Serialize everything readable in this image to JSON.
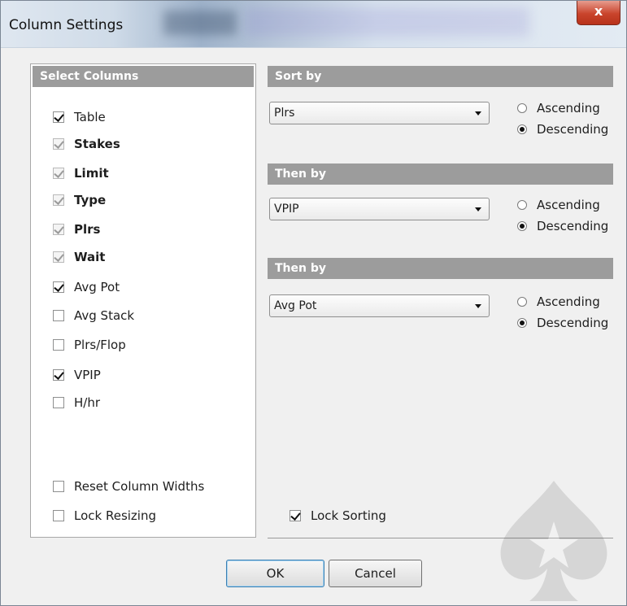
{
  "window": {
    "title": "Column Settings",
    "close_glyph": "x"
  },
  "select_columns": {
    "header": "Select Columns",
    "items": [
      {
        "label": "Table",
        "checked": true,
        "disabled": false,
        "bold": false
      },
      {
        "label": "Stakes",
        "checked": true,
        "disabled": true,
        "bold": true
      },
      {
        "label": "Limit",
        "checked": true,
        "disabled": true,
        "bold": true
      },
      {
        "label": "Type",
        "checked": true,
        "disabled": true,
        "bold": true
      },
      {
        "label": "Plrs",
        "checked": true,
        "disabled": true,
        "bold": true
      },
      {
        "label": "Wait",
        "checked": true,
        "disabled": true,
        "bold": true
      },
      {
        "label": "Avg Pot",
        "checked": true,
        "disabled": false,
        "bold": false
      },
      {
        "label": "Avg Stack",
        "checked": false,
        "disabled": false,
        "bold": false
      },
      {
        "label": "Plrs/Flop",
        "checked": false,
        "disabled": false,
        "bold": false
      },
      {
        "label": "VPIP",
        "checked": true,
        "disabled": false,
        "bold": false
      },
      {
        "label": "H/hr",
        "checked": false,
        "disabled": false,
        "bold": false
      }
    ],
    "reset_widths": {
      "label": "Reset Column Widths",
      "checked": false
    },
    "lock_resizing": {
      "label": "Lock Resizing",
      "checked": false
    }
  },
  "sort": {
    "groups": [
      {
        "header": "Sort by",
        "selected": "Plrs",
        "ascending": "Ascending",
        "descending": "Descending",
        "order": "descending"
      },
      {
        "header": "Then by",
        "selected": "VPIP",
        "ascending": "Ascending",
        "descending": "Descending",
        "order": "descending"
      },
      {
        "header": "Then by",
        "selected": "Avg Pot",
        "ascending": "Ascending",
        "descending": "Descending",
        "order": "descending"
      }
    ],
    "lock_sorting": {
      "label": "Lock Sorting",
      "checked": true
    }
  },
  "buttons": {
    "ok": "OK",
    "cancel": "Cancel"
  },
  "colors": {
    "group_header_bg": "#9c9c9c",
    "dialog_bg": "#f0f0f0",
    "close_button": "#c9442c"
  },
  "icons": {
    "watermark": "poker-spade-star-logo"
  }
}
